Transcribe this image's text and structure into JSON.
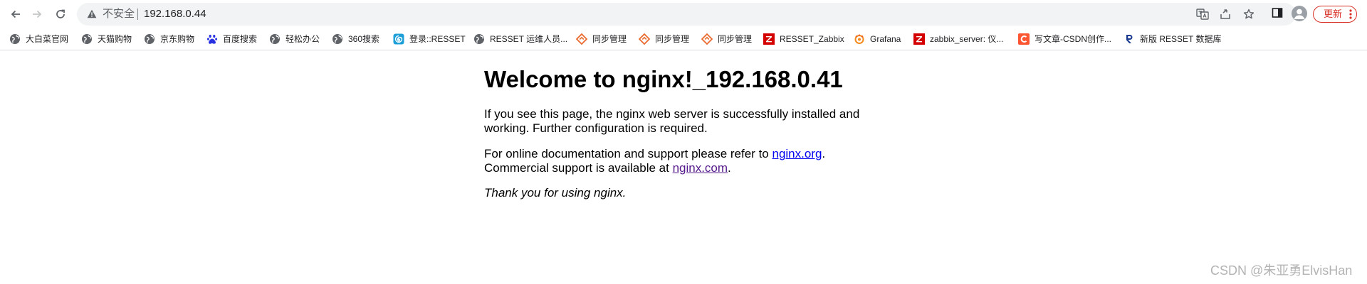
{
  "omnibox": {
    "security_label": "不安全",
    "url": "192.168.0.44"
  },
  "toolbar": {
    "update_label": "更新"
  },
  "bookmarks": [
    {
      "label": "大白菜官网",
      "icon": "globe-icon"
    },
    {
      "label": "天猫购物",
      "icon": "globe-icon"
    },
    {
      "label": "京东购物",
      "icon": "globe-icon"
    },
    {
      "label": "百度搜索",
      "icon": "baidu-paw-icon"
    },
    {
      "label": "轻松办公",
      "icon": "globe-icon"
    },
    {
      "label": "360搜索",
      "icon": "globe-icon"
    },
    {
      "label": "登录::RESSET",
      "icon": "swirl-icon"
    },
    {
      "label": "RESSET 运维人员...",
      "icon": "globe-icon"
    },
    {
      "label": "同步管理",
      "icon": "diamond-logo-icon"
    },
    {
      "label": "同步管理",
      "icon": "diamond-logo-icon"
    },
    {
      "label": "同步管理",
      "icon": "diamond-logo-icon"
    },
    {
      "label": "RESSET_Zabbix",
      "icon": "zabbix-z-icon"
    },
    {
      "label": "Grafana",
      "icon": "grafana-icon"
    },
    {
      "label": "zabbix_server: 仪...",
      "icon": "zabbix-z-icon"
    },
    {
      "label": "写文章-CSDN创作...",
      "icon": "csdn-c-icon"
    },
    {
      "label": "新版 RESSET 数据库",
      "icon": "resset-r-icon"
    }
  ],
  "page": {
    "heading": "Welcome to nginx!_192.168.0.41",
    "para1": "If you see this page, the nginx web server is successfully installed and working. Further configuration is required.",
    "para2_prefix": "For online documentation and support please refer to ",
    "link1": "nginx.org",
    "para2_mid": ".",
    "para2_line2": "Commercial support is available at ",
    "link2": "nginx.com",
    "para2_end": ".",
    "thanks": "Thank you for using nginx."
  },
  "watermark": "CSDN @朱亚勇ElvisHan",
  "colors": {
    "link": "#0000ee",
    "visited_link": "#551a8b",
    "update_red": "#d93025",
    "zabbix_red": "#d40000",
    "csdn_orange": "#fc5531"
  }
}
